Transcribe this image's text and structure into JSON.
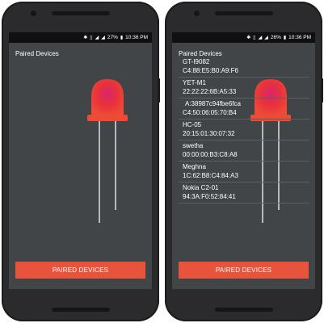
{
  "left_phone": {
    "status_bar": {
      "icons": [
        "bluetooth-icon",
        "vibrate-icon",
        "wifi-icon",
        "signal-icon",
        "battery-icon"
      ],
      "battery": "27%",
      "time": "10:36 PM"
    },
    "title": "Paired Devices",
    "button_label": "PAIRED DEVICES"
  },
  "right_phone": {
    "status_bar": {
      "icons": [
        "bluetooth-icon",
        "vibrate-icon",
        "wifi-icon",
        "signal-icon",
        "battery-icon"
      ],
      "battery": "26%",
      "time": "10:36 PM"
    },
    "title": "Paired Devices",
    "devices": [
      {
        "name": "GT-I9082",
        "address": "C4:88:E5:B0:A9:F6"
      },
      {
        "name": "YET-M1",
        "address": "22:22:22:6B:A5:33"
      },
      {
        "name": "",
        "address": "A:38987c94fbe6fca"
      },
      {
        "name": "",
        "address": "C4:50:06:05:70:B4"
      },
      {
        "name": "HC-05",
        "address": "20:15:01:30:07:32"
      },
      {
        "name": "swetha",
        "address": "00:00:00:B3:C8:A8"
      },
      {
        "name": "Meghna",
        "address": "1C:62:B8:C4:84:A3"
      },
      {
        "name": "Nokia C2-01",
        "address": "94:3A:F0:52:84:41"
      }
    ],
    "button_label": "PAIRED DEVICES"
  },
  "colors": {
    "screen_bg": "#414548",
    "accent": "#e8533c",
    "led": "#e8333a"
  }
}
